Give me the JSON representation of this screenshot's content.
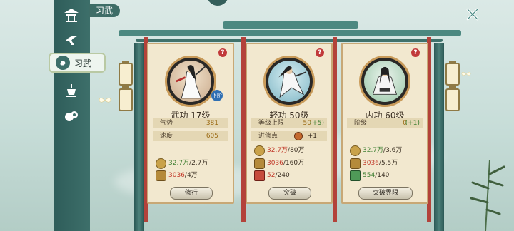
{
  "header": {
    "title_tag": "习武"
  },
  "sidebar": {
    "items": [
      {
        "name": "pavilion",
        "icon": "pavilion-icon"
      },
      {
        "name": "crane",
        "icon": "crane-icon"
      },
      {
        "name": "martial",
        "icon": "fist-icon",
        "label": "习武",
        "active": true
      },
      {
        "name": "incense",
        "icon": "incense-burner-icon"
      },
      {
        "name": "beast",
        "icon": "beast-icon"
      }
    ]
  },
  "cards": [
    {
      "skill": "武功",
      "level": "17级",
      "badge": "下阶",
      "stats": [
        {
          "label": "气势",
          "value": "381"
        },
        {
          "label": "速度",
          "value": "605"
        }
      ],
      "resources": [
        {
          "icon": "coin-icon",
          "current": "32.7万",
          "need": "/2.7万",
          "current_color": "green"
        },
        {
          "icon": "scroll-icon",
          "current": "3036",
          "need": "/4万",
          "current_color": "red"
        }
      ],
      "button": "修行"
    },
    {
      "skill": "轻功",
      "level": "50级",
      "stats": [
        {
          "label": "等级上限",
          "value": "50",
          "bonus": "(+5)"
        },
        {
          "label": "进修点",
          "value": "+1"
        }
      ],
      "resources": [
        {
          "icon": "coin-icon",
          "current": "32.7万",
          "need": "/80万",
          "current_color": "red"
        },
        {
          "icon": "scroll-icon",
          "current": "3036",
          "need": "/160万",
          "current_color": "red"
        },
        {
          "icon": "book-icon",
          "current": "52",
          "need": "/240",
          "current_color": "red"
        }
      ],
      "button": "突破"
    },
    {
      "skill": "内功",
      "level": "60级",
      "stats": [
        {
          "label": "阶级",
          "value": "0",
          "bonus": "(+1)"
        }
      ],
      "resources": [
        {
          "icon": "coin-icon",
          "current": "32.7万",
          "need": "/3.6万",
          "current_color": "green"
        },
        {
          "icon": "scroll-icon",
          "current": "3036",
          "need": "/5.5万",
          "current_color": "red"
        },
        {
          "icon": "book-icon",
          "current": "554",
          "need": "/140",
          "current_color": "green"
        }
      ],
      "button": "突破界限"
    }
  ]
}
